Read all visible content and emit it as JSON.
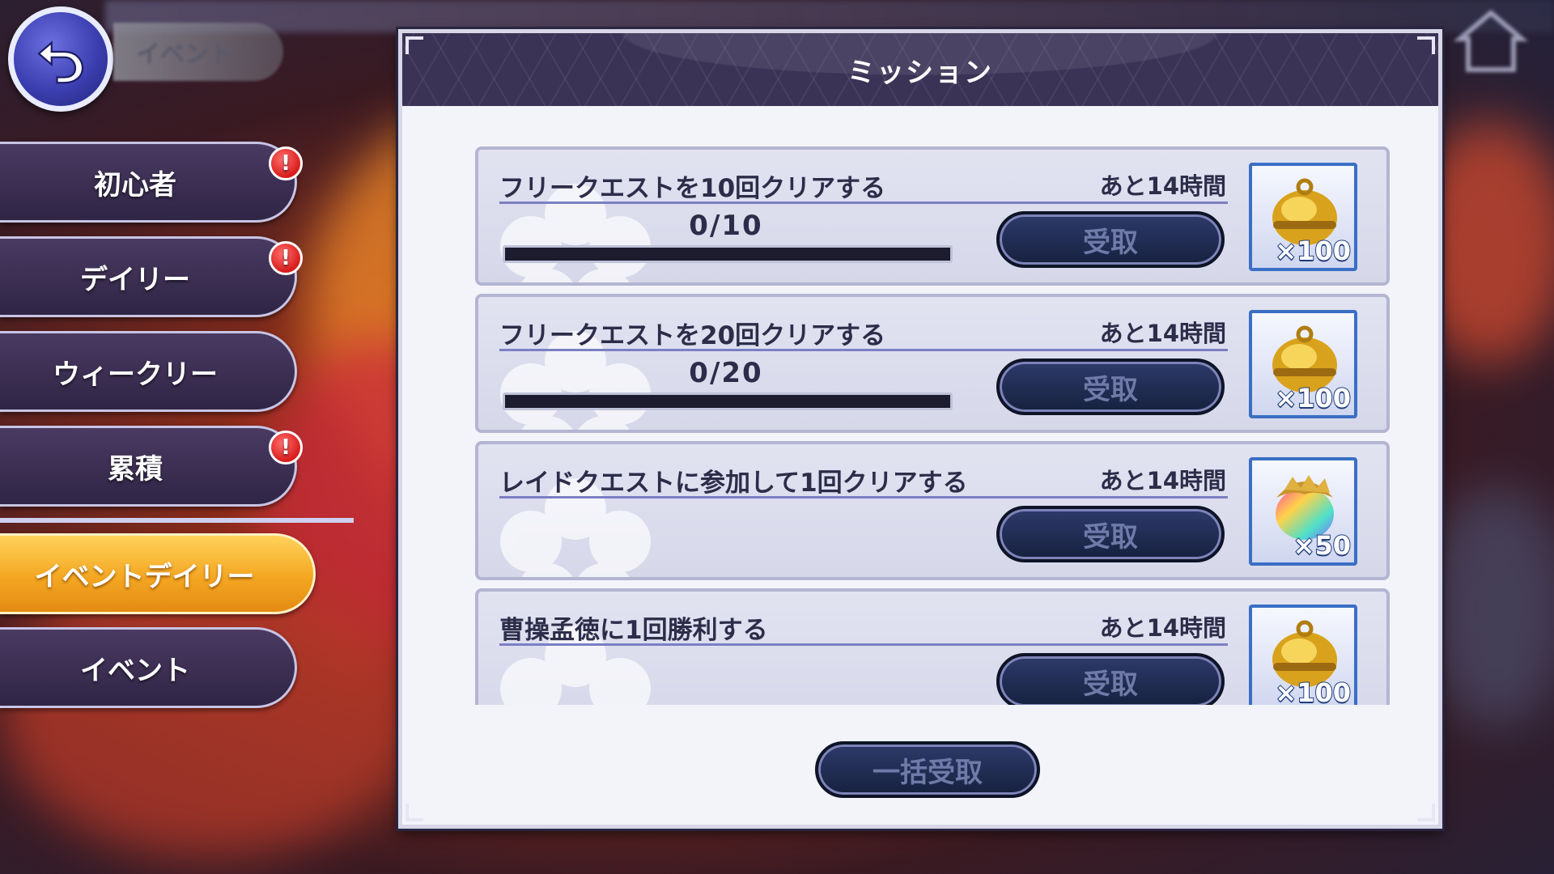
{
  "header": {
    "back_icon": "back-arrow-icon",
    "breadcrumb": "イベント"
  },
  "sidebar": {
    "items": [
      {
        "label": "初心者",
        "alert": true,
        "active": false
      },
      {
        "label": "デイリー",
        "alert": true,
        "active": false
      },
      {
        "label": "ウィークリー",
        "alert": false,
        "active": false
      },
      {
        "label": "累積",
        "alert": true,
        "active": false
      },
      {
        "label": "イベントデイリー",
        "alert": false,
        "active": true
      },
      {
        "label": "イベント",
        "alert": false,
        "active": false
      }
    ],
    "alert_mark": "!"
  },
  "panel": {
    "title": "ミッション",
    "bulk_claim_label": "一括受取"
  },
  "missions": [
    {
      "name": "フリークエストを10回クリアする",
      "time_left": "あと14時間",
      "progress_text": "0/10",
      "progress": 0,
      "claim_label": "受取",
      "reward_icon": "gold-bell-icon",
      "reward_qty": "×100"
    },
    {
      "name": "フリークエストを20回クリアする",
      "time_left": "あと14時間",
      "progress_text": "0/20",
      "progress": 0,
      "claim_label": "受取",
      "reward_icon": "gold-bell-icon",
      "reward_qty": "×100"
    },
    {
      "name": "レイドクエストに参加して1回クリアする",
      "time_left": "あと14時間",
      "progress_text": "",
      "progress": null,
      "claim_label": "受取",
      "reward_icon": "rainbow-orb-icon",
      "reward_qty": "×50"
    },
    {
      "name": "曹操孟徳に1回勝利する",
      "time_left": "あと14時間",
      "progress_text": "",
      "progress": null,
      "claim_label": "受取",
      "reward_icon": "gold-bell-icon",
      "reward_qty": "×100"
    }
  ],
  "colors": {
    "active_tab": "#f4a722",
    "panel_header": "#3b3356",
    "button_dark": "#16213f"
  }
}
